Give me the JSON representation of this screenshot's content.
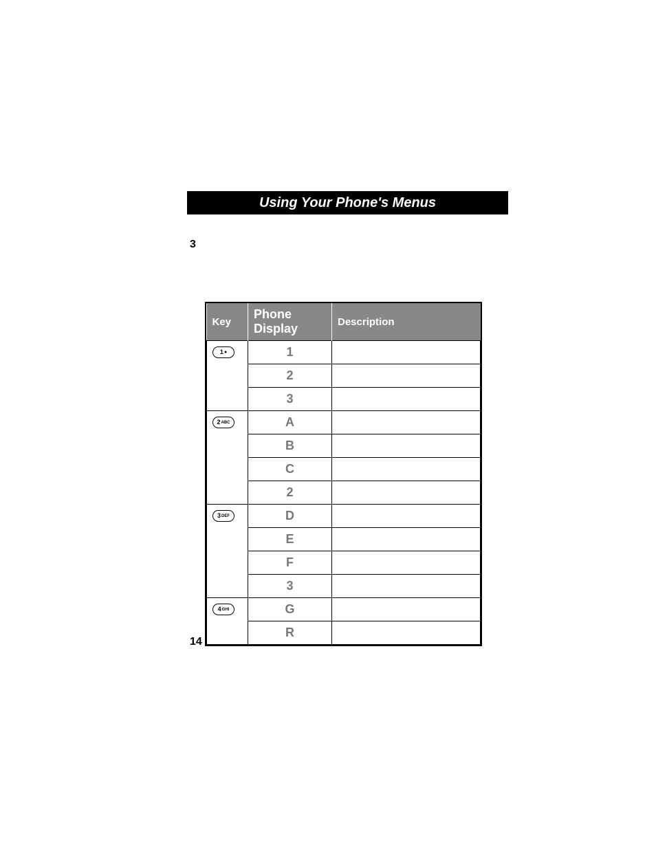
{
  "banner": "Using Your Phone's Menus",
  "section_num": "3",
  "page_num": "14",
  "table": {
    "headers": {
      "key": "Key",
      "display": "Phone Display",
      "desc": "Description"
    },
    "groups": [
      {
        "key_label": "1",
        "key_sub": "",
        "key_symbol": "●",
        "rows": [
          {
            "display": "1",
            "desc": ""
          },
          {
            "display": "2",
            "desc": ""
          },
          {
            "display": "3",
            "desc": ""
          }
        ]
      },
      {
        "key_label": "2",
        "key_sub": "ABC",
        "key_symbol": "",
        "rows": [
          {
            "display": "A",
            "desc": ""
          },
          {
            "display": "B",
            "desc": ""
          },
          {
            "display": "C",
            "desc": ""
          },
          {
            "display": "2",
            "desc": ""
          }
        ]
      },
      {
        "key_label": "3",
        "key_sub": "DEF",
        "key_symbol": "",
        "rows": [
          {
            "display": "D",
            "desc": ""
          },
          {
            "display": "E",
            "desc": ""
          },
          {
            "display": "F",
            "desc": ""
          },
          {
            "display": "3",
            "desc": ""
          }
        ]
      },
      {
        "key_label": "4",
        "key_sub": "GHI",
        "key_symbol": "",
        "rows": [
          {
            "display": "G",
            "desc": ""
          },
          {
            "display": "R",
            "desc": ""
          }
        ]
      }
    ]
  },
  "chart_data": {
    "type": "table",
    "title": "Using Your Phone's Menus",
    "columns": [
      "Key",
      "Phone Display",
      "Description"
    ],
    "rows": [
      [
        "1",
        "1",
        ""
      ],
      [
        "1",
        "2",
        ""
      ],
      [
        "1",
        "3",
        ""
      ],
      [
        "2 ABC",
        "A",
        ""
      ],
      [
        "2 ABC",
        "B",
        ""
      ],
      [
        "2 ABC",
        "C",
        ""
      ],
      [
        "2 ABC",
        "2",
        ""
      ],
      [
        "3 DEF",
        "D",
        ""
      ],
      [
        "3 DEF",
        "E",
        ""
      ],
      [
        "3 DEF",
        "F",
        ""
      ],
      [
        "3 DEF",
        "3",
        ""
      ],
      [
        "4 GHI",
        "G",
        ""
      ],
      [
        "4 GHI",
        "R",
        ""
      ]
    ]
  }
}
